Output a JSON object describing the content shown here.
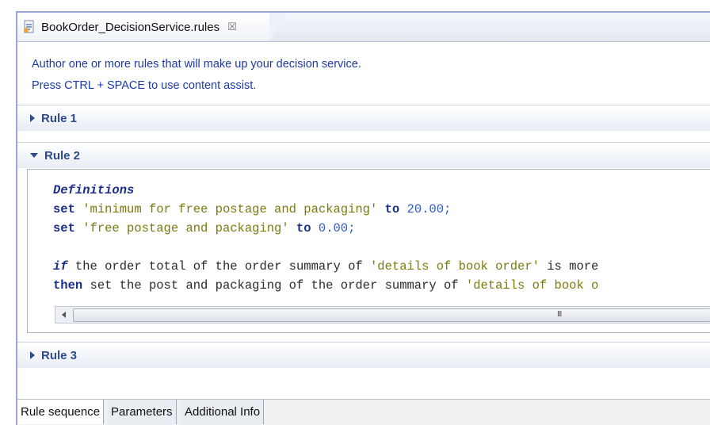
{
  "editor_tab": {
    "title": "BookOrder_DecisionService.rules",
    "close_symbol": "☒"
  },
  "intro": {
    "line1": "Author one or more rules that will make up your decision service.",
    "line2": "Press CTRL + SPACE to use content assist."
  },
  "rules": [
    {
      "label": "Rule 1",
      "expanded": false
    },
    {
      "label": "Rule 2",
      "expanded": true
    },
    {
      "label": "Rule 3",
      "expanded": false
    }
  ],
  "code": {
    "l1": {
      "kw": "Definitions"
    },
    "l2": {
      "kw": "set",
      "str": "'minimum for free postage and packaging'",
      "kw2": "to",
      "num": "20.00;"
    },
    "l3": {
      "kw": "set",
      "str": "'free postage and packaging'",
      "kw2": "to",
      "num": "0.00;"
    },
    "l4": {
      "kw": "if",
      "text": "the order total of the order summary of",
      "str": "'details of book order'",
      "text2": "is more"
    },
    "l5": {
      "kw": "then",
      "text": "set the post and packaging of the order summary of",
      "str": "'details of book o"
    }
  },
  "scrollbar": {
    "grip": "III"
  },
  "bottom_tabs": [
    "Rule sequence",
    "Parameters",
    "Additional Info"
  ],
  "colors": {
    "keyword": "#1a2f8c",
    "string": "#7a7a10",
    "number": "#2b5bc4",
    "intro": "#1f3aa6"
  }
}
